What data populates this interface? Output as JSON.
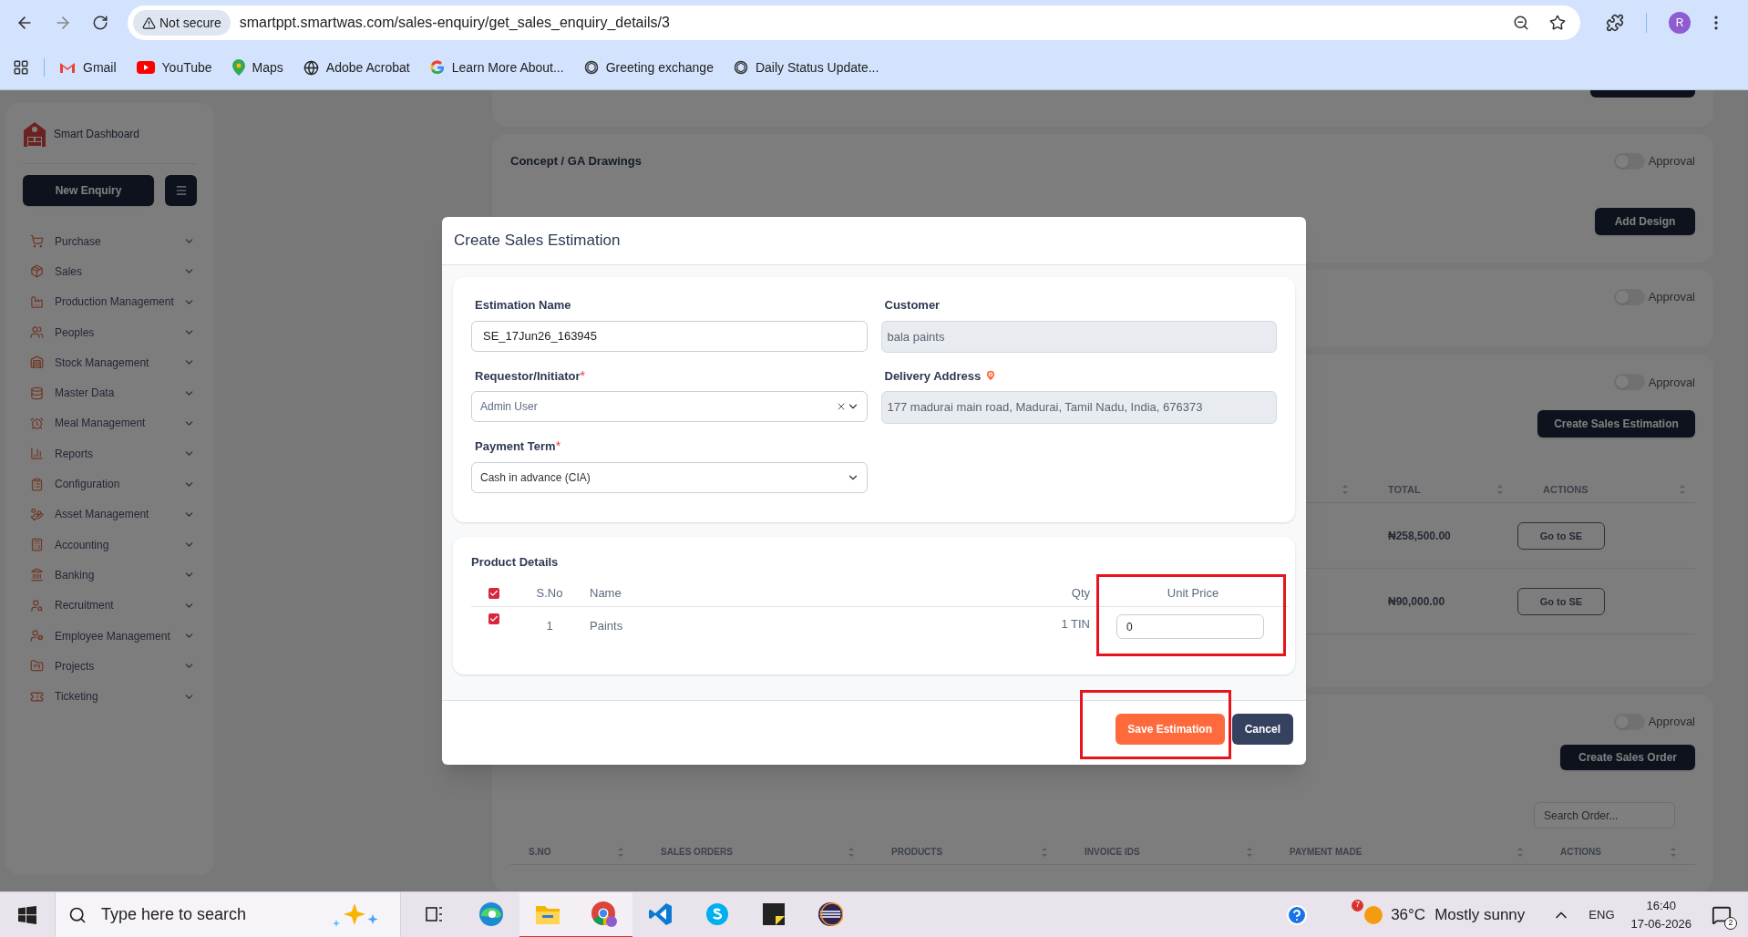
{
  "browser": {
    "security_label": "Not secure",
    "url": "smartppt.smartwas.com/sales-enquiry/get_sales_enquiry_details/3",
    "profile_initial": "R",
    "bookmarks": [
      {
        "label": "Gmail",
        "kind": "gmail"
      },
      {
        "label": "YouTube",
        "kind": "youtube"
      },
      {
        "label": "Maps",
        "kind": "maps"
      },
      {
        "label": "Adobe Acrobat",
        "kind": "globe"
      },
      {
        "label": "Learn More About...",
        "kind": "google"
      },
      {
        "label": "Greeting exchange",
        "kind": "openai"
      },
      {
        "label": "Daily Status Update...",
        "kind": "openai"
      }
    ]
  },
  "sidebar": {
    "brand": "Smart Dashboard",
    "new_enquiry_button": "New Enquiry",
    "menu": [
      {
        "label": "Purchase"
      },
      {
        "label": "Sales"
      },
      {
        "label": "Production Management"
      },
      {
        "label": "Peoples"
      },
      {
        "label": "Stock Management"
      },
      {
        "label": "Master Data"
      },
      {
        "label": "Meal Management"
      },
      {
        "label": "Reports"
      },
      {
        "label": "Configuration"
      },
      {
        "label": "Asset Management"
      },
      {
        "label": "Accounting"
      },
      {
        "label": "Banking"
      },
      {
        "label": "Recruitment"
      },
      {
        "label": "Employee Management"
      },
      {
        "label": "Projects"
      },
      {
        "label": "Ticketing"
      }
    ]
  },
  "page": {
    "design_section": {
      "title": "Concept / GA Drawings",
      "approval": {
        "label": "Approval",
        "on": false
      },
      "button": "Add Design"
    },
    "section_2": {
      "approval": {
        "label": "Approval",
        "on": false
      }
    },
    "estimation_section": {
      "approval": {
        "label": "Approval",
        "on": false
      },
      "button": "Create Sales Estimation",
      "columns": [
        {
          "label": "TOTAL"
        },
        {
          "label": "ACTIONS"
        }
      ],
      "rows": [
        {
          "total": "₦258,500.00",
          "action": "Go to SE"
        },
        {
          "total": "₦90,000.00",
          "action": "Go to SE"
        }
      ]
    },
    "orders_section": {
      "approval": {
        "label": "Approval",
        "on": false
      },
      "button": "Create Sales Order",
      "search": {
        "placeholder": "Search Order..."
      },
      "columns": [
        {
          "label": "S.NO"
        },
        {
          "label": "SALES ORDERS"
        },
        {
          "label": "PRODUCTS"
        },
        {
          "label": "INVOICE IDS"
        },
        {
          "label": "PAYMENT MADE"
        },
        {
          "label": "ACTIONS"
        }
      ]
    }
  },
  "modal": {
    "title": "Create Sales Estimation",
    "fields": [
      {
        "label": "Estimation Name",
        "kind": "text",
        "value": "SE_17Jun26_163945"
      },
      {
        "label": "Customer",
        "kind": "readonly",
        "value": "bala paints"
      },
      {
        "label": "Requestor/Initiator",
        "kind": "select",
        "value": "Admin User",
        "required_mark": "*",
        "clearable": true
      },
      {
        "label": "Delivery Address",
        "kind": "readonly",
        "value": "177 madurai main road, Madurai, Tamil Nadu, India, 676373",
        "location_icon": true
      },
      {
        "label": "Payment Term",
        "kind": "select",
        "value": "Cash in advance (CIA)",
        "required_mark": "*",
        "clearable": false
      }
    ],
    "product_details": {
      "title": "Product Details",
      "select_all_checked": true,
      "columns": [
        {
          "label": "S.No"
        },
        {
          "label": "Name"
        },
        {
          "label": "Qty"
        },
        {
          "label": "Unit Price",
          "highlighted": true
        }
      ],
      "rows": [
        {
          "checked": true,
          "sno": "1",
          "name": "Paints",
          "qty": "1 TIN",
          "unit_price": "0"
        }
      ]
    },
    "buttons": [
      {
        "label": "Save Estimation",
        "kind": "primary",
        "highlighted": true
      },
      {
        "label": "Cancel",
        "kind": "secondary",
        "highlighted": false
      }
    ]
  },
  "taskbar": {
    "search_placeholder": "Type here to search",
    "apps": [
      {
        "kind": "taskview",
        "running": false
      },
      {
        "kind": "edge",
        "running": false
      },
      {
        "kind": "explorer",
        "running": true
      },
      {
        "kind": "chrome",
        "running": true
      },
      {
        "kind": "vscode",
        "running": false
      },
      {
        "kind": "skype",
        "running": false
      },
      {
        "kind": "sticky",
        "running": false
      },
      {
        "kind": "eclipse",
        "running": false
      }
    ],
    "weather": {
      "badge": "7",
      "temperature": "36°C",
      "condition": "Mostly sunny"
    },
    "language": "ENG",
    "time": "16:40",
    "date": "17-06-2026",
    "notification_count": "2"
  }
}
